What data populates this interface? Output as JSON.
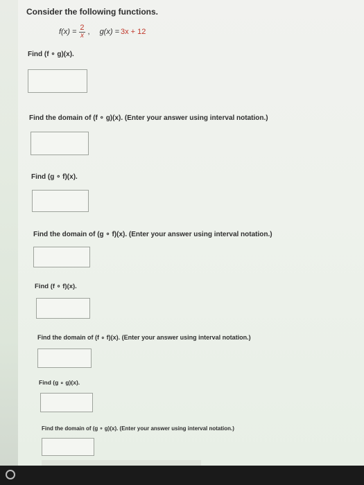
{
  "question": {
    "title": "Consider the following functions.",
    "f_label": "f(x) =",
    "f_numerator": "2",
    "f_denominator": "x",
    "separator": ",",
    "g_label": "g(x) =",
    "g_expr": "3x + 12"
  },
  "parts": [
    {
      "prompt": "Find  (f ∘ g)(x)."
    },
    {
      "prompt": "Find the domain of  (f ∘ g)(x).  (Enter your answer using interval notation.)"
    },
    {
      "prompt": "Find  (g ∘ f)(x)."
    },
    {
      "prompt": "Find the domain of  (g ∘ f)(x).  (Enter your answer using interval notation.)"
    },
    {
      "prompt": "Find  (f ∘ f)(x)."
    },
    {
      "prompt": "Find the domain of  (f ∘ f)(x).  (Enter your answer using interval notation.)"
    },
    {
      "prompt": "Find  (g ∘ g)(x)."
    },
    {
      "prompt": "Find the domain of  (g ∘ g)(x).  (Enter your answer using interval notation.)"
    }
  ],
  "answers": [
    "",
    "",
    "",
    "",
    "",
    "",
    "",
    ""
  ]
}
